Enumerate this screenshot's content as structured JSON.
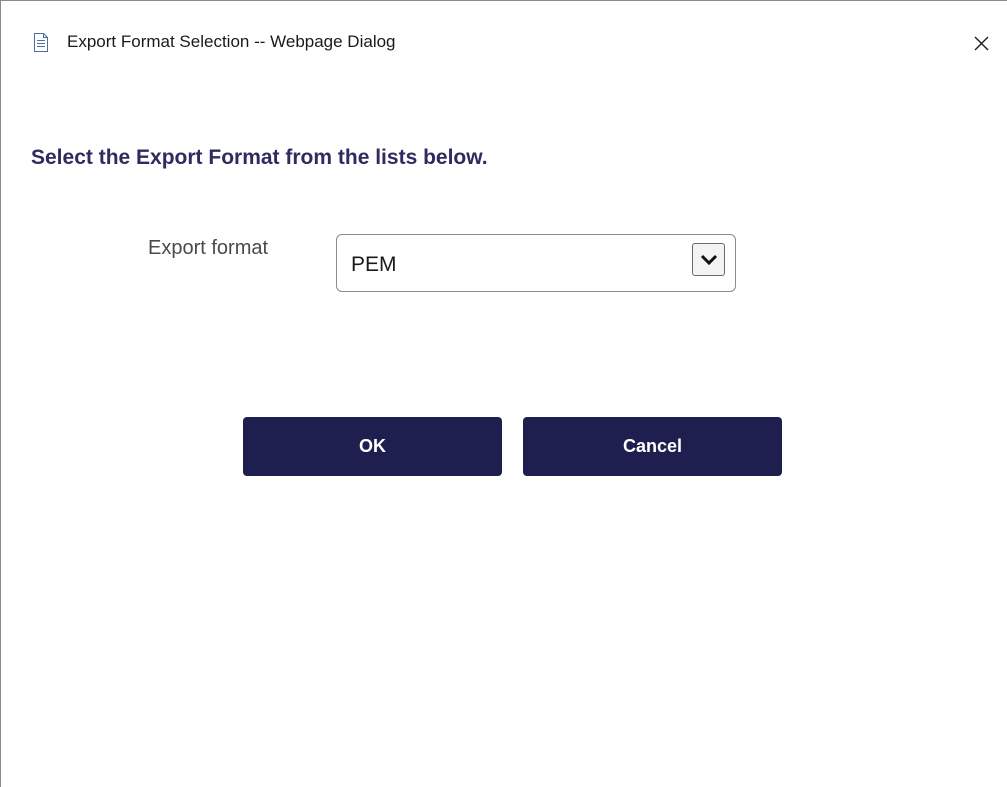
{
  "window": {
    "title": "Export Format Selection -- Webpage Dialog",
    "title_icon": "document-icon",
    "close_icon": "close-icon"
  },
  "main": {
    "heading": "Select the Export Format from the lists below.",
    "export_format": {
      "label": "Export format",
      "selected": "PEM",
      "icon": "chevron-down-icon"
    },
    "buttons": {
      "ok_label": "OK",
      "cancel_label": "Cancel"
    }
  },
  "colors": {
    "heading": "#2e2c5e",
    "button_bg": "#1f1f4f",
    "button_text": "#ffffff"
  }
}
